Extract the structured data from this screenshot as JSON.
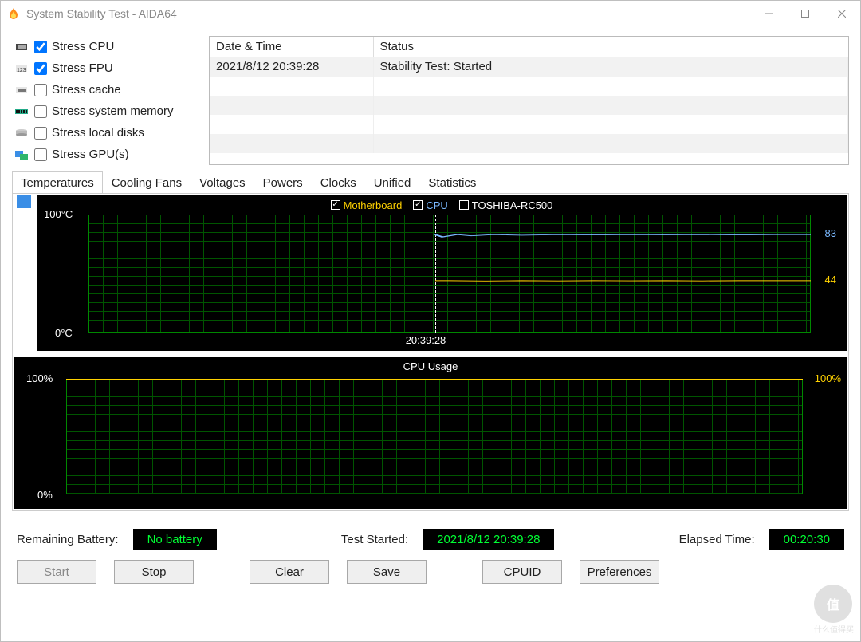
{
  "window_title": "System Stability Test - AIDA64",
  "stress_options": [
    {
      "label": "Stress CPU",
      "checked": true
    },
    {
      "label": "Stress FPU",
      "checked": true
    },
    {
      "label": "Stress cache",
      "checked": false
    },
    {
      "label": "Stress system memory",
      "checked": false
    },
    {
      "label": "Stress local disks",
      "checked": false
    },
    {
      "label": "Stress GPU(s)",
      "checked": false
    }
  ],
  "log_headers": {
    "date": "Date & Time",
    "status": "Status"
  },
  "log_rows": [
    {
      "date": "2021/8/12 20:39:28",
      "status": "Stability Test: Started"
    }
  ],
  "tabs": [
    "Temperatures",
    "Cooling Fans",
    "Voltages",
    "Powers",
    "Clocks",
    "Unified",
    "Statistics"
  ],
  "active_tab": 0,
  "temp_legend": [
    {
      "name": "Motherboard",
      "checked": true,
      "color": "#ffd200"
    },
    {
      "name": "CPU",
      "checked": true,
      "color": "#7bb9ff"
    },
    {
      "name": "TOSHIBA-RC500",
      "checked": false,
      "color": "#ffffff"
    }
  ],
  "temp_axis": {
    "y_top": "100°C",
    "y_bottom": "0°C",
    "x_marker": "20:39:28",
    "cpu_value": "83",
    "mobo_value": "44"
  },
  "cpu_usage": {
    "title": "CPU Usage",
    "y_top": "100%",
    "y_bottom": "0%",
    "right_top": "100%"
  },
  "status": {
    "battery_label": "Remaining Battery:",
    "battery_value": "No battery",
    "started_label": "Test Started:",
    "started_value": "2021/8/12 20:39:28",
    "elapsed_label": "Elapsed Time:",
    "elapsed_value": "00:20:30"
  },
  "buttons": [
    "Start",
    "Stop",
    "Clear",
    "Save",
    "CPUID",
    "Preferences"
  ],
  "watermark": "什么值得买",
  "chart_data": [
    {
      "type": "line",
      "title": "Temperatures",
      "ylim": [
        0,
        100
      ],
      "ylabel": "°C",
      "x_marker": "20:39:28",
      "series": [
        {
          "name": "CPU",
          "color": "#7bb9ff",
          "value_steady": 83
        },
        {
          "name": "Motherboard",
          "color": "#ffd200",
          "value_steady": 44
        },
        {
          "name": "TOSHIBA-RC500",
          "color": "#ffffff",
          "value_steady": null,
          "shown": false
        }
      ]
    },
    {
      "type": "line",
      "title": "CPU Usage",
      "ylim": [
        0,
        100
      ],
      "ylabel": "%",
      "series": [
        {
          "name": "Usage",
          "color": "#ffd200",
          "value_steady": 100
        }
      ]
    }
  ]
}
